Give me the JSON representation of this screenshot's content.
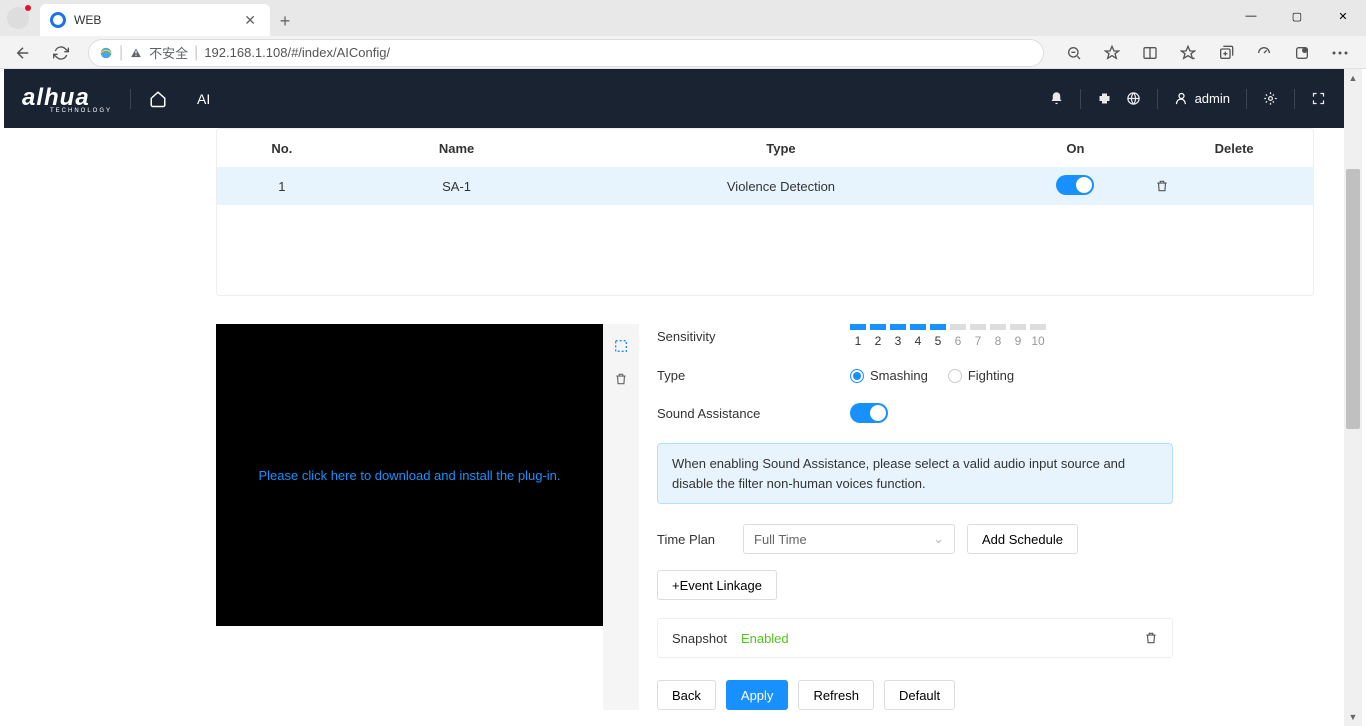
{
  "browser": {
    "tab_title": "WEB",
    "security_label": "不安全",
    "url": "192.168.1.108/#/index/AIConfig/"
  },
  "header": {
    "logo": "alhua",
    "logo_sub": "TECHNOLOGY",
    "ai_label": "AI",
    "username": "admin"
  },
  "table": {
    "headers": {
      "no": "No.",
      "name": "Name",
      "type": "Type",
      "on": "On",
      "delete": "Delete"
    },
    "rows": [
      {
        "no": "1",
        "name": "SA-1",
        "type": "Violence Detection",
        "on": true
      }
    ]
  },
  "video": {
    "plugin_text": "Please click here to download and install the plug-in."
  },
  "form": {
    "sensitivity_label": "Sensitivity",
    "sensitivity_value": 5,
    "sensitivity_scale": [
      "1",
      "2",
      "3",
      "4",
      "5",
      "6",
      "7",
      "8",
      "9",
      "10"
    ],
    "type_label": "Type",
    "type_options": {
      "smashing": "Smashing",
      "fighting": "Fighting"
    },
    "type_selected": "smashing",
    "sound_label": "Sound Assistance",
    "sound_on": true,
    "info_text": "When enabling Sound Assistance, please select a valid audio input source and disable the filter non-human voices function.",
    "timeplan_label": "Time Plan",
    "timeplan_value": "Full Time",
    "add_schedule": "Add Schedule",
    "event_linkage": "+Event Linkage",
    "snapshot_label": "Snapshot",
    "snapshot_status": "Enabled",
    "buttons": {
      "back": "Back",
      "apply": "Apply",
      "refresh": "Refresh",
      "default": "Default"
    }
  }
}
